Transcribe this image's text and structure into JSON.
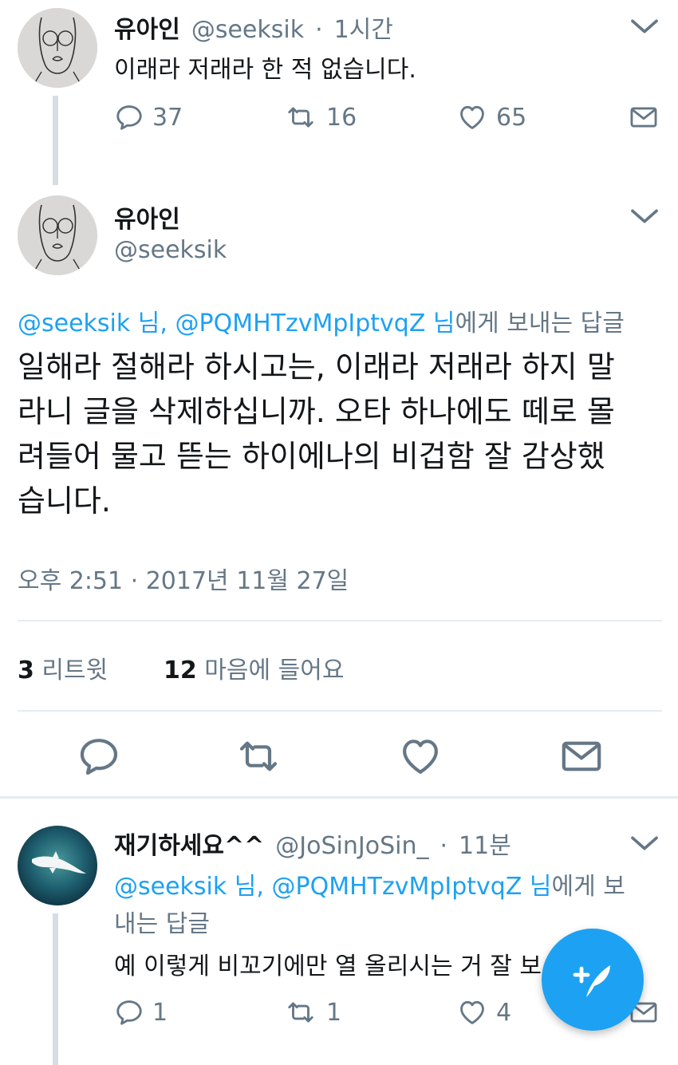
{
  "tweet1": {
    "display_name": "유아인",
    "handle": "@seeksik",
    "separator": "·",
    "time": "1시간",
    "text": "이래라 저래라 한 적 없습니다.",
    "reply_count": "37",
    "retweet_count": "16",
    "like_count": "65"
  },
  "main_tweet": {
    "display_name": "유아인",
    "handle": "@seeksik",
    "reply_to": {
      "mention1": "@seeksik 님,",
      "mention2": "@PQMHTzvMpIptvqZ 님",
      "suffix": "에게 보내는 답글"
    },
    "text_lines": [
      "일해라 절해라 하시고는, 이래라 저래라 하지 말",
      "라니 글을 삭제하십니까. 오타 하나에도 떼로 몰",
      "려들어 물고 뜯는 하이에나의 비겁함 잘 감상했",
      "습니다."
    ],
    "timestamp": "오후 2:51 · 2017년 11월 27일",
    "retweets_num": "3",
    "retweets_label": "리트윗",
    "likes_num": "12",
    "likes_label": "마음에 들어요"
  },
  "reply_tweet": {
    "display_name": "재기하세요^^",
    "handle": "@JoSinJoSin_",
    "separator": "·",
    "time": "11분",
    "reply_to": {
      "mention1": "@seeksik 님,",
      "mention2": "@PQMHTzvMpIptvqZ 님",
      "suffix_line1": "에게 보",
      "suffix_line2": "내는 답글"
    },
    "text": "예 이렇게 비꼬기에만 열 올리시는 거 잘 보",
    "reply_count": "1",
    "retweet_count": "1",
    "like_count": "4"
  },
  "colors": {
    "accent": "#1da1f2",
    "secondary_text": "#657786",
    "primary_text": "#14171a",
    "divider": "#e6ecf0"
  }
}
